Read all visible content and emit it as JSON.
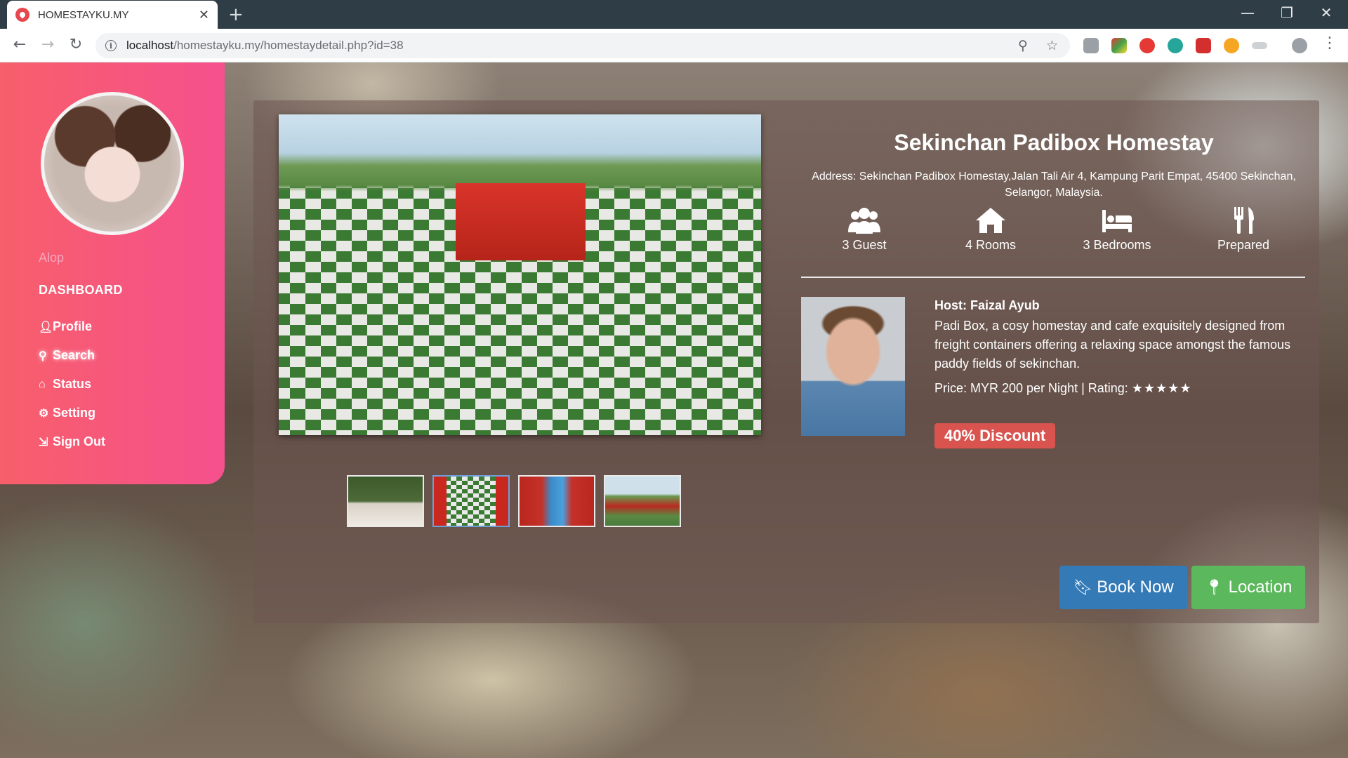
{
  "browser": {
    "tab_title": "HOMESTAYKU.MY",
    "url_host": "localhost",
    "url_path": "/homestayku.my/homestaydetail.php?id=38"
  },
  "sidebar": {
    "user_name": "Alop",
    "heading": "DASHBOARD",
    "items": [
      {
        "label": "Profile",
        "icon": "user-icon"
      },
      {
        "label": "Search",
        "icon": "search-icon"
      },
      {
        "label": "Status",
        "icon": "home-icon"
      },
      {
        "label": "Setting",
        "icon": "gear-icon"
      },
      {
        "label": "Sign Out",
        "icon": "sign-out-icon"
      }
    ]
  },
  "homestay": {
    "title": "Sekinchan Padibox Homestay",
    "address": "Address: Sekinchan Padibox Homestay,Jalan Tali Air 4, Kampung Parit Empat, 45400 Sekinchan, Selangor, Malaysia.",
    "features": [
      {
        "label": "3 Guest",
        "icon": "users-icon"
      },
      {
        "label": "4 Rooms",
        "icon": "home-icon"
      },
      {
        "label": "3 Bedrooms",
        "icon": "bed-icon"
      },
      {
        "label": "Prepared",
        "icon": "cutlery-icon"
      }
    ],
    "host_label": "Host: Faizal Ayub",
    "description": "Padi Box, a cosy homestay and cafe exquisitely designed from freight containers offering a relaxing space amongst the famous paddy fields of sekinchan.",
    "price_text": "Price: MYR 200 per Night | Rating:",
    "rating_stars": "★★★★★",
    "rating": 5,
    "discount": "40% Discount",
    "thumbnail_count": 4,
    "selected_thumbnail": 2
  },
  "actions": {
    "book_label": "Book Now",
    "location_label": "Location"
  },
  "colors": {
    "sidebar_start": "#f75f6a",
    "sidebar_end": "#f6508e",
    "book_button": "#337ab7",
    "location_button": "#5cb85c",
    "discount_badge": "#d9534f"
  }
}
